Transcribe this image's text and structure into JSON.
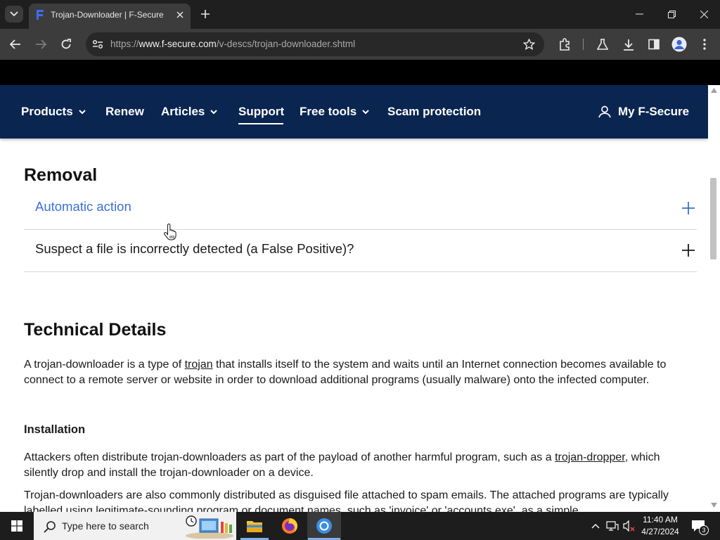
{
  "browser": {
    "tab_title": "Trojan-Downloader | F-Secure",
    "url_prefix": "https://",
    "url_domain": "www.f-secure.com",
    "url_path": "/v-descs/trojan-downloader.shtml"
  },
  "nav": {
    "products": "Products",
    "renew": "Renew",
    "articles": "Articles",
    "support": "Support",
    "free_tools": "Free tools",
    "scam_protection": "Scam protection",
    "my_fsecure": "My F-Secure"
  },
  "removal": {
    "heading": "Removal",
    "items": [
      {
        "label": "Automatic action"
      },
      {
        "label": "Suspect a file is incorrectly detected (a False Positive)?"
      }
    ]
  },
  "technical": {
    "heading": "Technical Details",
    "intro_before": "A trojan-downloader is a type of ",
    "intro_link": "trojan",
    "intro_after": " that installs itself to the system and waits until an Internet connection becomes available to connect to a remote server or website in order to download additional programs (usually malware) onto the infected computer.",
    "installation_heading": "Installation",
    "install_p1_before": "Attackers often distribute trojan-downloaders as part of the payload of another harmful program, such as a ",
    "install_p1_link": "trojan-dropper",
    "install_p1_after": ", which silently drop and install the trojan-downloader on a device.",
    "install_p2": "Trojan-downloaders are also commonly distributed as disguised file attached to spam emails. The attached programs are typically labelled using legitimate-sounding program or document names, such as 'invoice' or 'accounts.exe', as a simple"
  },
  "taskbar": {
    "search_placeholder": "Type here to search",
    "time": "11:40 AM",
    "date": "4/27/2024",
    "notifications_count": "3"
  },
  "colors": {
    "nav_bg": "#0a2550",
    "link_blue": "#3d6fd6",
    "tab_strip": "#1f1f1f",
    "toolbar": "#3c3c3c"
  }
}
